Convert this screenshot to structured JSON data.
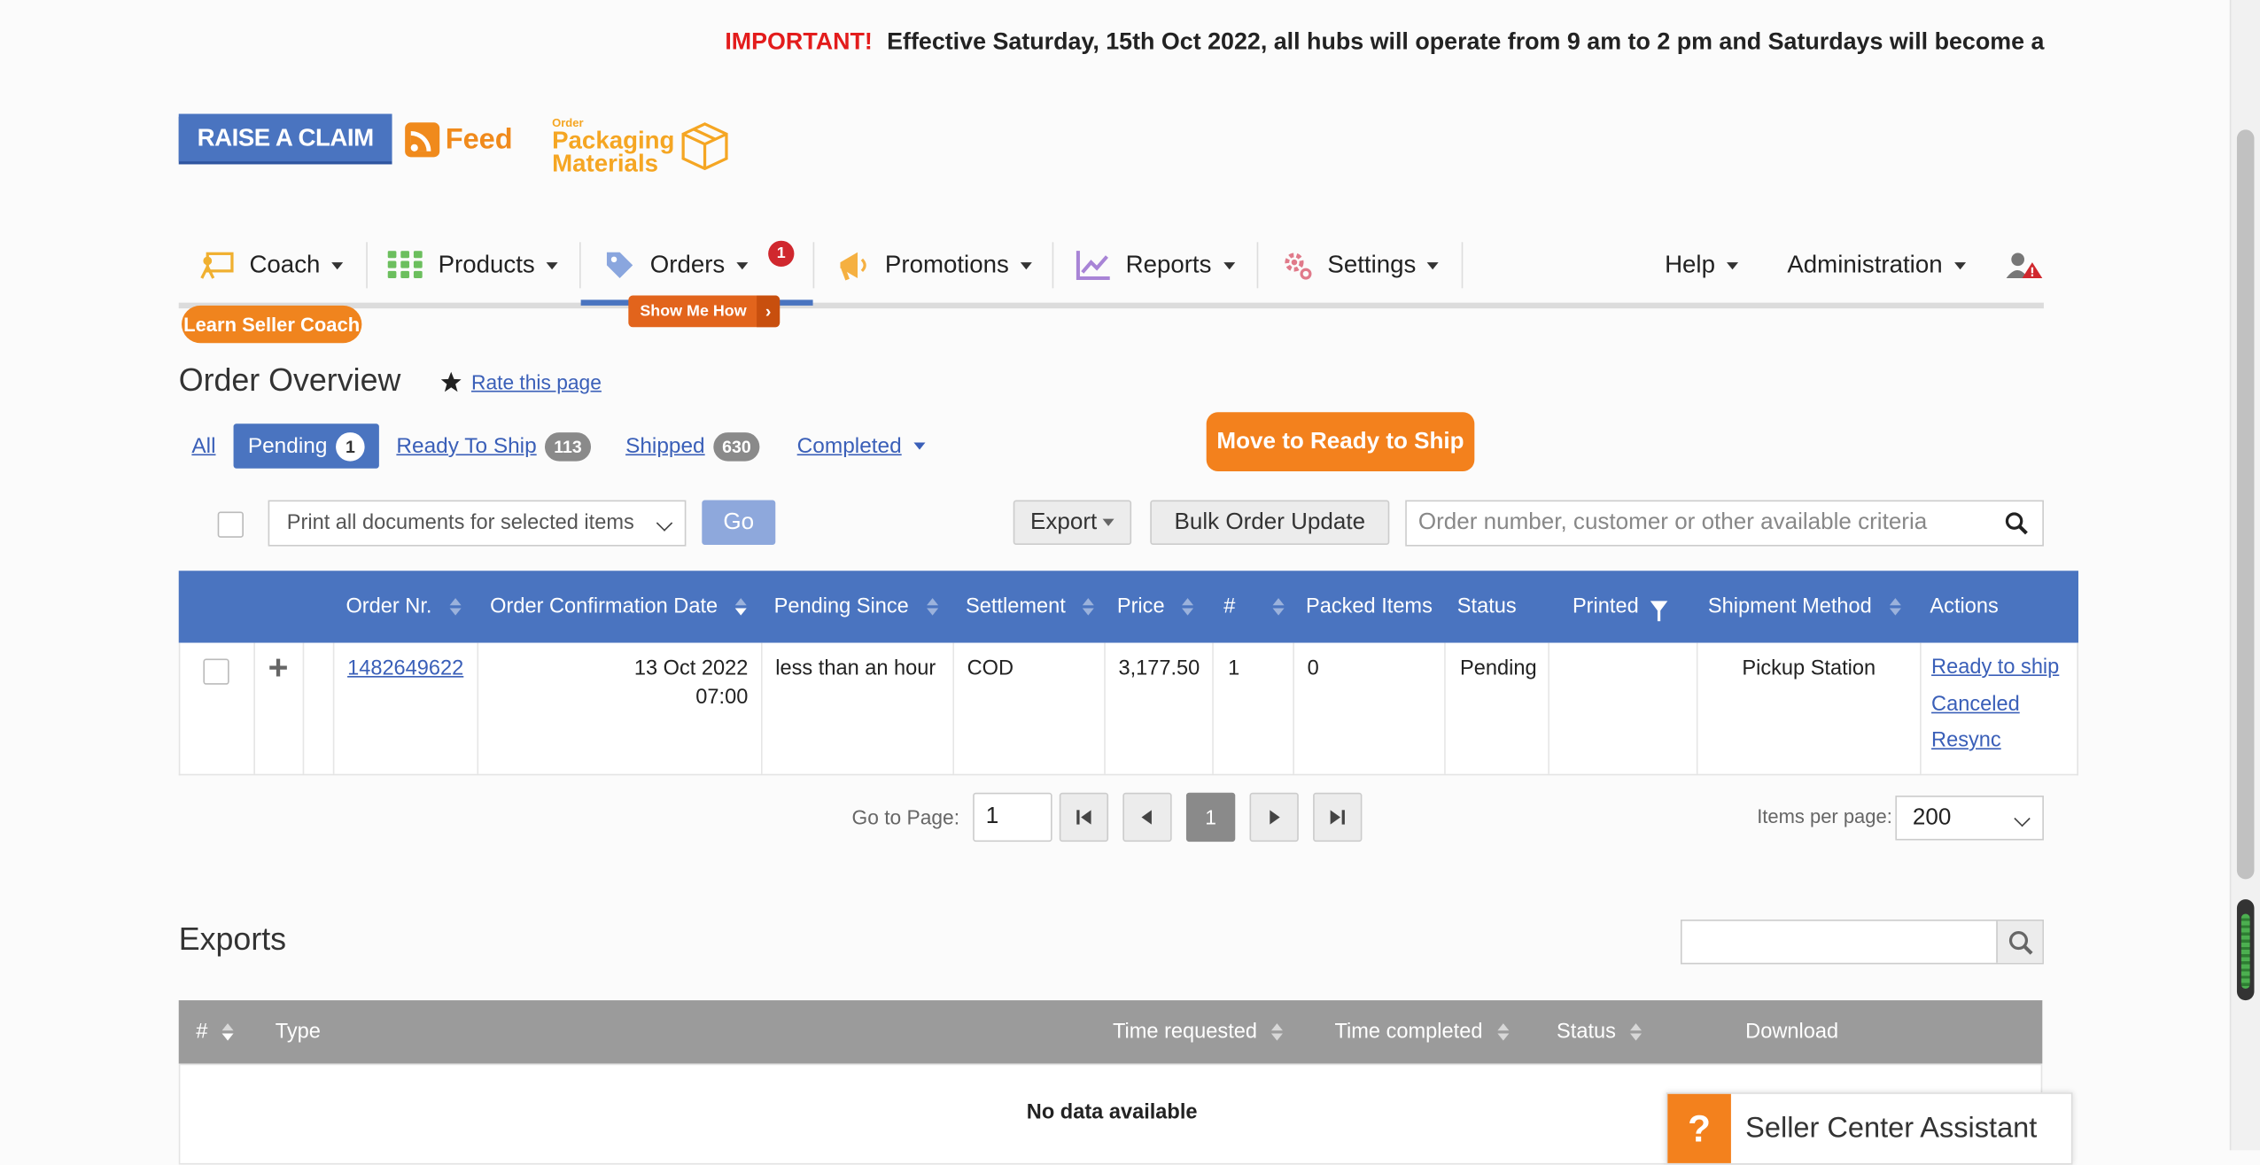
{
  "announcement": {
    "label": "IMPORTANT!",
    "text": "Effective Saturday, 15th Oct 2022, all hubs will operate from 9 am to 2 pm and Saturdays will become a"
  },
  "banners": {
    "raise_claim": "RAISE A CLAIM",
    "feed": "Feed",
    "packaging_small": "Order",
    "packaging_line1": "Packaging",
    "packaging_line2": "Materials"
  },
  "nav": {
    "items": [
      {
        "label": "Coach",
        "icon": "coach-icon"
      },
      {
        "label": "Products",
        "icon": "grid-icon"
      },
      {
        "label": "Orders",
        "icon": "tag-icon",
        "badge": "1"
      },
      {
        "label": "Promotions",
        "icon": "megaphone-icon"
      },
      {
        "label": "Reports",
        "icon": "chart-icon"
      },
      {
        "label": "Settings",
        "icon": "gear-icon"
      }
    ],
    "help": "Help",
    "administration": "Administration",
    "show_me_how": "Show Me How",
    "learn_coach": "Learn Seller Coach",
    "accent": "#4a74c0"
  },
  "page": {
    "title": "Order Overview",
    "rate": "Rate this page"
  },
  "tabs": {
    "all": "All",
    "pending": "Pending",
    "pending_count": "1",
    "ready": "Ready To Ship",
    "ready_count": "113",
    "shipped": "Shipped",
    "shipped_count": "630",
    "completed": "Completed"
  },
  "actions": {
    "move_ready": "Move to Ready to Ship",
    "print_select": "Print all documents for selected items",
    "go": "Go",
    "export": "Export",
    "bulk_update": "Bulk Order Update",
    "search_placeholder": "Order number, customer or other available criteria"
  },
  "orders": {
    "columns": [
      "Order Nr.",
      "Order Confirmation Date",
      "Pending Since",
      "Settlement",
      "Price",
      "#",
      "Packed Items",
      "Status",
      "Printed",
      "Shipment Method",
      "Actions"
    ],
    "rows": [
      {
        "order_nr": "1482649622",
        "date": "13 Oct 2022",
        "time": "07:00",
        "pending_since": "less than an hour",
        "settlement": "COD",
        "price": "3,177.50",
        "count": "1",
        "packed": "0",
        "status": "Pending",
        "printed": "",
        "shipment": "Pickup Station",
        "actions": [
          "Ready to ship",
          "Canceled",
          "Resync"
        ]
      }
    ]
  },
  "pagination": {
    "goto_label": "Go to Page:",
    "goto_value": "1",
    "current": "1",
    "ipp_label": "Items per page:",
    "ipp_value": "200"
  },
  "exports": {
    "title": "Exports",
    "columns": [
      "#",
      "Type",
      "Time requested",
      "Time completed",
      "Status",
      "Download"
    ],
    "empty": "No data available"
  },
  "assistant": {
    "label": "Seller Center Assistant",
    "icon": "?"
  }
}
